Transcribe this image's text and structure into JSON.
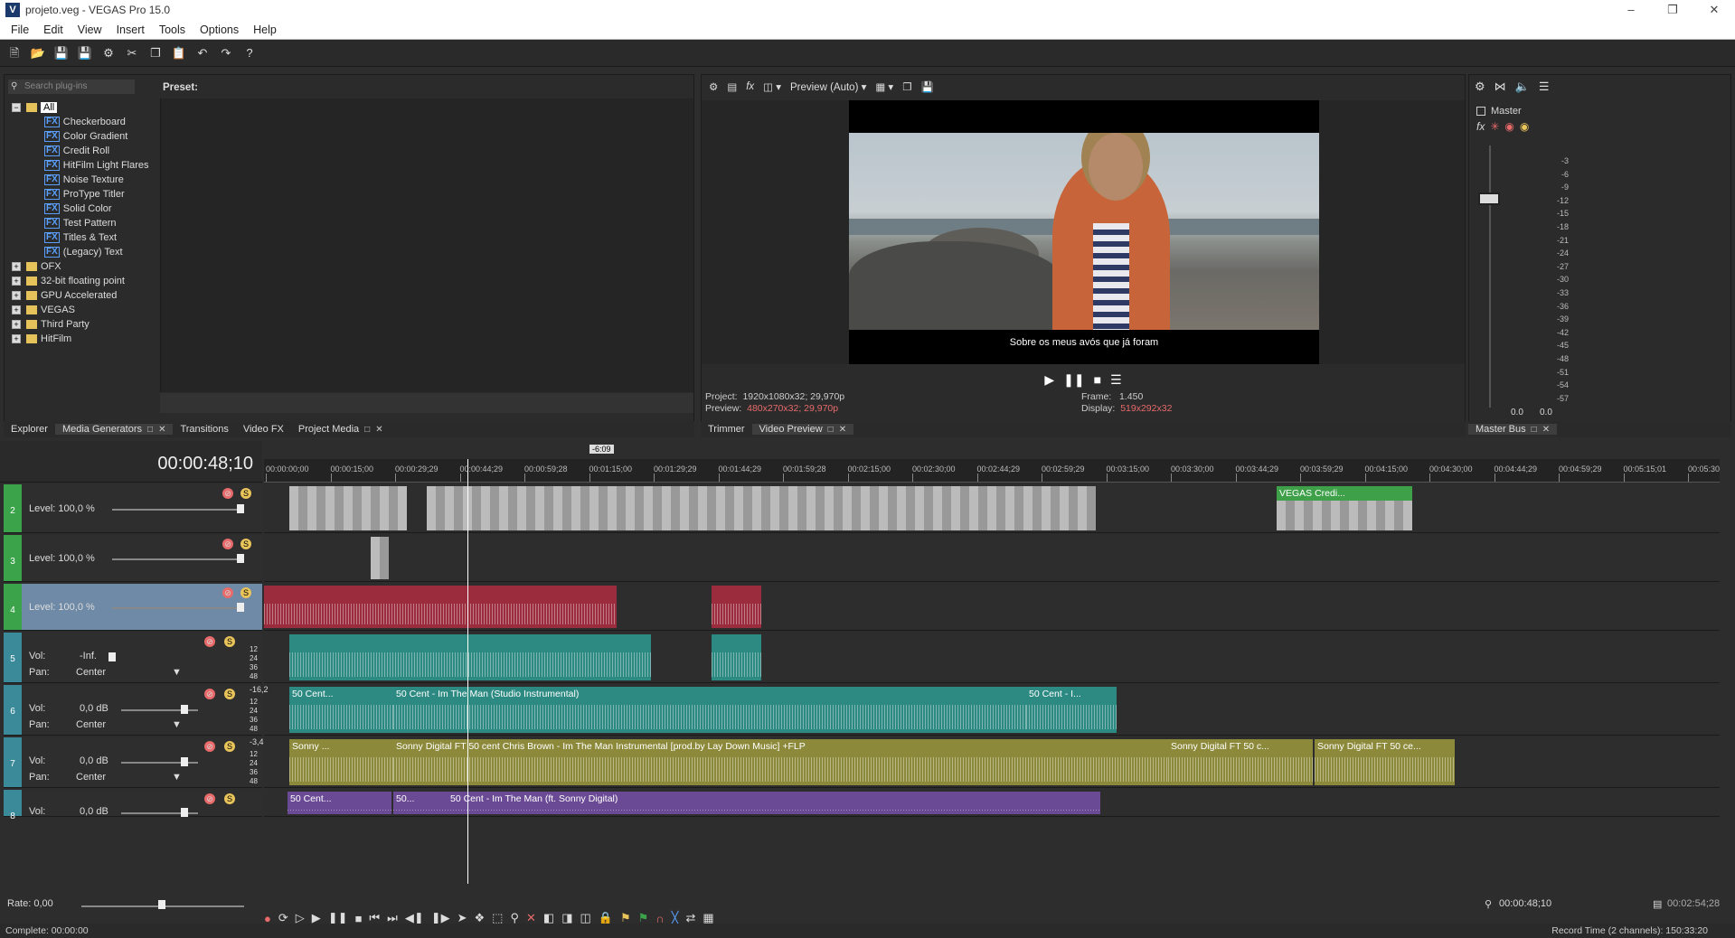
{
  "window": {
    "title": "projeto.veg - VEGAS Pro 15.0",
    "app_icon": "V"
  },
  "menu": [
    "File",
    "Edit",
    "View",
    "Insert",
    "Tools",
    "Options",
    "Help"
  ],
  "explorer": {
    "search_placeholder": "Search plug-ins",
    "preset_label": "Preset:",
    "tree": [
      {
        "type": "folder",
        "label": "All",
        "expanded": true,
        "selected": true
      },
      {
        "type": "fx",
        "label": "Checkerboard"
      },
      {
        "type": "fx",
        "label": "Color Gradient"
      },
      {
        "type": "fx",
        "label": "Credit Roll"
      },
      {
        "type": "fx",
        "label": "HitFilm Light Flares"
      },
      {
        "type": "fx",
        "label": "Noise Texture"
      },
      {
        "type": "fx",
        "label": "ProType Titler"
      },
      {
        "type": "fx",
        "label": "Solid Color"
      },
      {
        "type": "fx",
        "label": "Test Pattern"
      },
      {
        "type": "fx",
        "label": "Titles & Text"
      },
      {
        "type": "fx",
        "label": "(Legacy) Text"
      },
      {
        "type": "folder",
        "label": "OFX"
      },
      {
        "type": "folder",
        "label": "32-bit floating point"
      },
      {
        "type": "folder",
        "label": "GPU Accelerated"
      },
      {
        "type": "folder",
        "label": "VEGAS"
      },
      {
        "type": "folder",
        "label": "Third Party"
      },
      {
        "type": "folder",
        "label": "HitFilm"
      }
    ],
    "tabs": [
      "Explorer",
      "Media Generators",
      "Transitions",
      "Video FX",
      "Project Media"
    ]
  },
  "preview": {
    "mode": "Preview (Auto)",
    "subtitle": "Sobre os meus avós que já foram",
    "project_label": "Project:",
    "project_value": "1920x1080x32; 29,970p",
    "preview_label": "Preview:",
    "preview_value": "480x270x32; 29,970p",
    "frame_label": "Frame:",
    "frame_value": "1.450",
    "display_label": "Display:",
    "display_value": "519x292x32",
    "tabs": [
      "Trimmer",
      "Video Preview"
    ]
  },
  "mixer": {
    "master_label": "Master",
    "ticks": [
      "-3",
      "-6",
      "-9",
      "-12",
      "-15",
      "-18",
      "-21",
      "-24",
      "-27",
      "-30",
      "-33",
      "-36",
      "-39",
      "-42",
      "-45",
      "-48",
      "-51",
      "-54",
      "-57"
    ],
    "bottom_left": "0.0",
    "bottom_right": "0.0",
    "tab": "Master Bus"
  },
  "timeline": {
    "timecode": "00:00:48;10",
    "marker": "-6:09",
    "ruler": [
      "00:00:00;00",
      "00:00:15;00",
      "00:00:29;29",
      "00:00:44;29",
      "00:00:59;28",
      "00:01:15;00",
      "00:01:29;29",
      "00:01:44;29",
      "00:01:59;28",
      "00:02:15;00",
      "00:02:30;00",
      "00:02:44;29",
      "00:02:59;29",
      "00:03:15;00",
      "00:03:30;00",
      "00:03:44;29",
      "00:03:59;29",
      "00:04:15;00",
      "00:04:30;00",
      "00:04:44;29",
      "00:04:59;29",
      "00:05:15;01",
      "00:05:30;00"
    ],
    "tracks": [
      {
        "num": "2",
        "kind": "video",
        "level": "Level: 100,0 %"
      },
      {
        "num": "3",
        "kind": "video",
        "level": "Level: 100,0 %"
      },
      {
        "num": "4",
        "kind": "video",
        "level": "Level: 100,0 %"
      },
      {
        "num": "5",
        "kind": "audio",
        "vol": "Vol:",
        "vol_value": "-Inf.",
        "pan": "Pan:",
        "pan_value": "Center"
      },
      {
        "num": "6",
        "kind": "audio",
        "vol": "Vol:",
        "vol_value": "0,0 dB",
        "pan": "Pan:",
        "pan_value": "Center",
        "meter_peak": "-16,2"
      },
      {
        "num": "7",
        "kind": "audio",
        "vol": "Vol:",
        "vol_value": "0,0 dB",
        "pan": "Pan:",
        "pan_value": "Center",
        "meter_peak": "-3,4"
      },
      {
        "num": "8",
        "kind": "audio",
        "vol": "Vol:",
        "vol_value": "0,0 dB"
      }
    ],
    "meter_scale": [
      "12",
      "24",
      "36",
      "48"
    ],
    "clips": {
      "credits": "VEGAS Credi...",
      "t6a": "50 Cent...",
      "t6b": "50 Cent - Im The Man (Studio Instrumental)",
      "t6c": "50 Cent - I...",
      "t7a": "Sonny ...",
      "t7b": "Sonny Digital FT 50 cent Chris Brown - Im The Man Instrumental [prod.by Lay Down Music] +FLP",
      "t7c": "Sonny Digital FT 50 c...",
      "t7d": "Sonny Digital FT 50 ce...",
      "t8a": "50 Cent...",
      "t8b": "50...",
      "t8c": "50 Cent - Im The Man (ft. Sonny Digital)"
    },
    "rate": "Rate: 0,00",
    "cursor_time": "00:00:48;10",
    "length_time": "00:02:54;28"
  },
  "status": {
    "left": "Complete: 00:00:00",
    "right": "Record Time (2 channels): 150:33:20"
  },
  "colors": {
    "video_header": "#3ba34a",
    "audio_teal": "#2d8a82",
    "audio_olive": "#8c8a3a",
    "audio_purple": "#6a4a94",
    "audio_red": "#9b2c3e",
    "highlight": "#e86a6a"
  }
}
